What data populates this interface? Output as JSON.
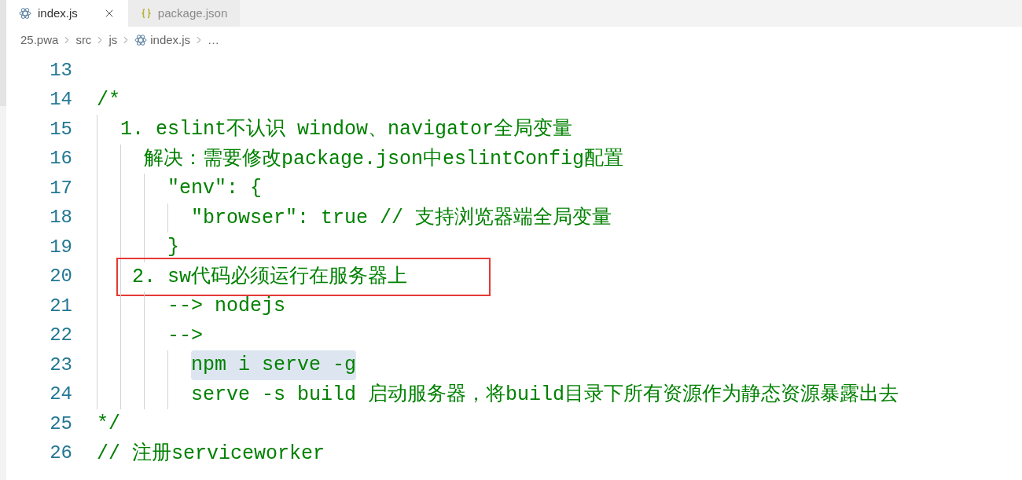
{
  "tabs": [
    {
      "label": "index.js",
      "selected": true,
      "kind": "javascript"
    },
    {
      "label": "package.json",
      "selected": false,
      "kind": "json"
    }
  ],
  "breadcrumb": [
    {
      "label": "25.pwa",
      "kind": "folder"
    },
    {
      "label": "src",
      "kind": "folder"
    },
    {
      "label": "js",
      "kind": "folder"
    },
    {
      "label": "index.js",
      "kind": "javascript"
    },
    {
      "label": "…",
      "kind": "more"
    }
  ],
  "lines": [
    {
      "number": "13",
      "highlighted": false,
      "boxed": false
    },
    {
      "number": "14",
      "text": "/*",
      "highlighted": false,
      "boxed": false
    },
    {
      "number": "15",
      "text": "  1. eslint不认识 window、navigator全局变量",
      "highlighted": false,
      "boxed": false
    },
    {
      "number": "16",
      "text": "    解决：需要修改package.json中eslintConfig配置",
      "highlighted": false,
      "boxed": false
    },
    {
      "number": "17",
      "text": "      \"env\": {",
      "highlighted": false,
      "boxed": false
    },
    {
      "number": "18",
      "text": "        \"browser\": true // 支持浏览器端全局变量",
      "highlighted": false,
      "boxed": false
    },
    {
      "number": "19",
      "text": "      }",
      "highlighted": false,
      "boxed": false
    },
    {
      "number": "20",
      "text": "   2. sw代码必须运行在服务器上",
      "highlighted": false,
      "boxed": true
    },
    {
      "number": "21",
      "text": "      --> nodejs",
      "highlighted": false,
      "boxed": false
    },
    {
      "number": "22",
      "text": "      -->",
      "highlighted": false,
      "boxed": false
    },
    {
      "number": "23",
      "text": "        npm i serve -g",
      "highlighted": true,
      "boxed": false
    },
    {
      "number": "24",
      "text": "        serve -s build 启动服务器，将build目录下所有资源作为静态资源暴露出去",
      "highlighted": false,
      "boxed": false
    },
    {
      "number": "25",
      "text": "*/",
      "highlighted": false,
      "boxed": false
    },
    {
      "number": "26",
      "text": "// 注册serviceworker",
      "highlighted": false,
      "boxed": false
    }
  ]
}
